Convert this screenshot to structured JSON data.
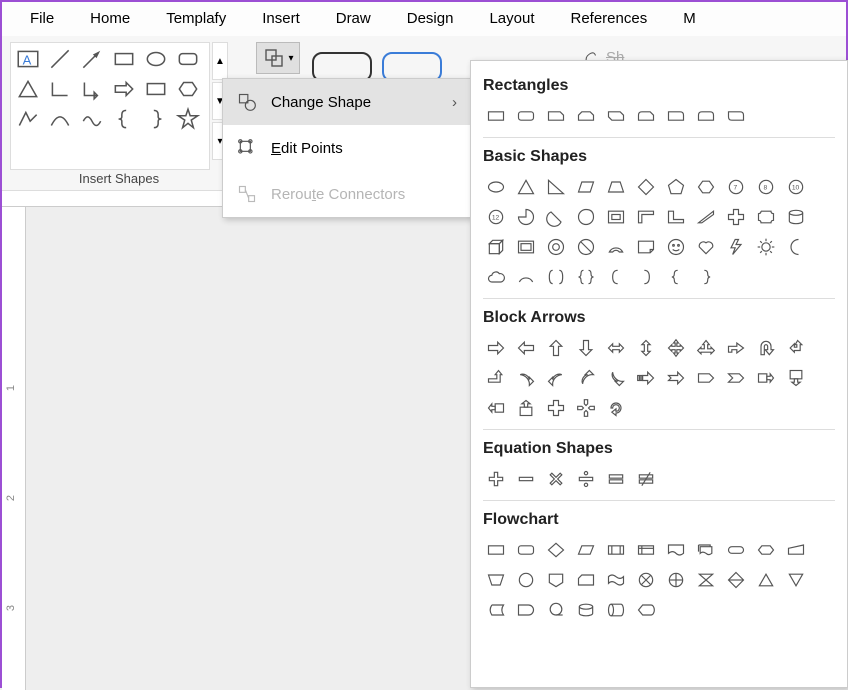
{
  "menubar": [
    "File",
    "Home",
    "Templafy",
    "Insert",
    "Draw",
    "Design",
    "Layout",
    "References",
    "M"
  ],
  "ribbon": {
    "group_label": "Insert Shapes",
    "edit_shape_label": "Edit Shape",
    "partial_text": "Shape Fill"
  },
  "dropdown": {
    "change_shape": "Change Shape",
    "edit_points": "Edit Points",
    "reroute_connectors": "Reroute Connectors"
  },
  "flyout": {
    "rectangles": "Rectangles",
    "basic_shapes": "Basic Shapes",
    "block_arrows": "Block Arrows",
    "equation_shapes": "Equation Shapes",
    "flowchart": "Flowchart"
  },
  "ruler": {
    "n1": "1",
    "n2": "2",
    "n3": "3"
  }
}
